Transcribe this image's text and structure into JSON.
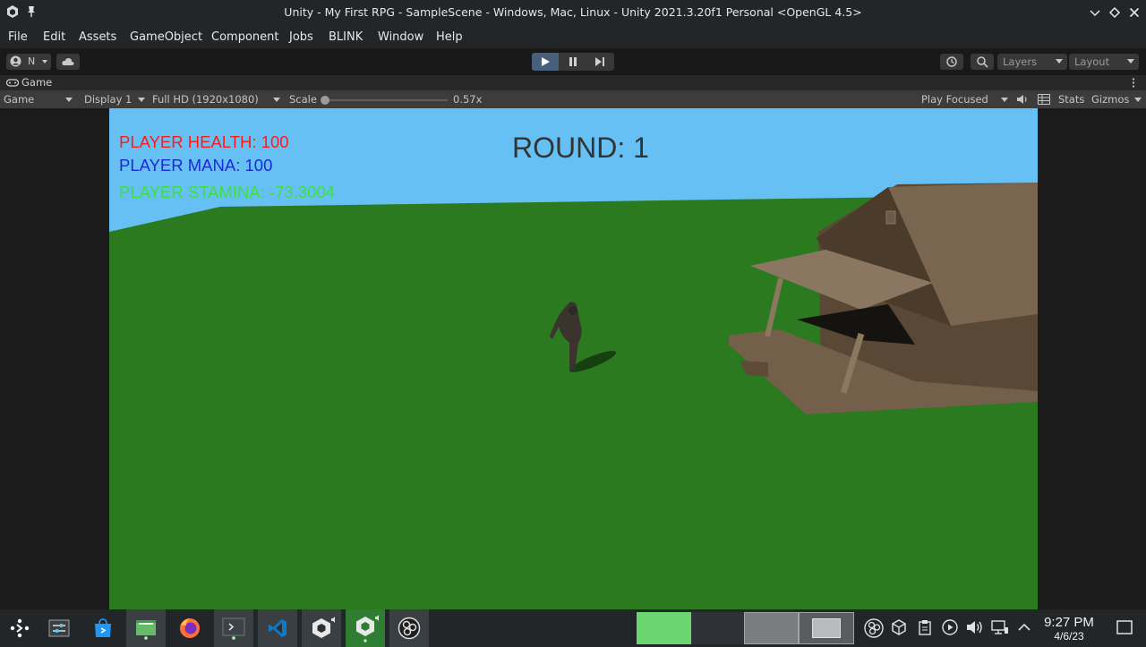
{
  "window": {
    "title": "Unity - My First RPG - SampleScene - Windows, Mac, Linux - Unity 2021.3.20f1 Personal <OpenGL 4.5>"
  },
  "menu": [
    "File",
    "Edit",
    "Assets",
    "GameObject",
    "Component",
    "Jobs",
    "BLINK",
    "Window",
    "Help"
  ],
  "toolbar": {
    "account_label": "N",
    "layers_label": "Layers",
    "layout_label": "Layout"
  },
  "game_tab": {
    "title": "Game",
    "view_select": "Game",
    "display_select": "Display 1",
    "resolution_select": "Full HD (1920x1080)",
    "scale_label": "Scale",
    "scale_value": "0.57x",
    "play_mode_select": "Play Focused",
    "stats_label": "Stats",
    "gizmos_label": "Gizmos"
  },
  "hud": {
    "health": "PLAYER HEALTH: 100",
    "mana": "PLAYER MANA: 100",
    "stamina": "PLAYER STAMINA: -73.3004",
    "round": "ROUND: 1",
    "colors": {
      "health": "#ff1a1a",
      "mana": "#1a2bd6",
      "stamina": "#3ee03e",
      "round": "#333333"
    }
  },
  "scene_colors": {
    "sky": "#66c0f4",
    "ground": "#2c7a1f"
  },
  "taskbar": {
    "apps": [
      "app-launcher-icon",
      "mixer-icon",
      "discover-store-icon",
      "file-manager-icon",
      "firefox-icon",
      "terminal-icon",
      "vscode-icon",
      "unity-hub-icon",
      "unity-editor-icon",
      "obs-icon"
    ],
    "tray": [
      "obs-tray-icon",
      "cube-tray-icon",
      "clipboard-icon",
      "media-player-icon",
      "volume-icon",
      "network-icon",
      "expand-tray-icon"
    ],
    "time": "9:27 PM",
    "date": "4/6/23"
  }
}
